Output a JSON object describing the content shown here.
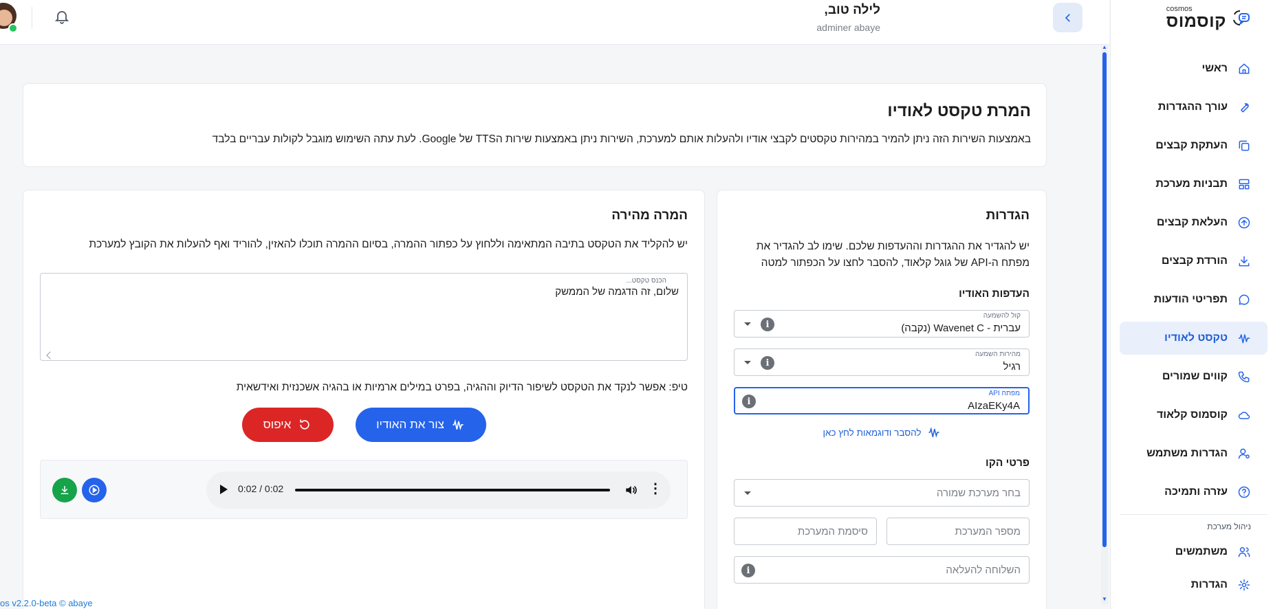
{
  "brand": {
    "small": "cosmos",
    "big": "קוסמוס"
  },
  "header": {
    "greeting": "לילה טוב,",
    "username": "adminer abaye"
  },
  "sidebar": {
    "items": [
      {
        "label": "ראשי",
        "icon": "home-icon"
      },
      {
        "label": "עורך ההגדרות",
        "icon": "wrench-icon"
      },
      {
        "label": "העתקת קבצים",
        "icon": "copy-icon"
      },
      {
        "label": "תבניות מערכת",
        "icon": "layout-icon"
      },
      {
        "label": "העלאת קבצים",
        "icon": "upload-icon"
      },
      {
        "label": "הורדת קבצים",
        "icon": "download-icon"
      },
      {
        "label": "תפריטי הודעות",
        "icon": "message-icon"
      },
      {
        "label": "טקסט לאודיו",
        "icon": "audio-wave-icon",
        "active": true
      },
      {
        "label": "קווים שמורים",
        "icon": "phone-icon"
      },
      {
        "label": "קוסמוס קלאוד",
        "icon": "cloud-icon"
      },
      {
        "label": "הגדרות משתמש",
        "icon": "user-settings-icon"
      },
      {
        "label": "עזרה ותמיכה",
        "icon": "help-icon"
      }
    ],
    "section_label": "ניהול מערכת",
    "admin_items": [
      {
        "label": "משתמשים",
        "icon": "users-icon"
      },
      {
        "label": "הגדרות",
        "icon": "gear-icon"
      }
    ]
  },
  "intro": {
    "title": "המרת טקסט לאודיו",
    "description": "באמצעות השירות הזה ניתן להמיר במהירות טקסטים לקבצי אודיו ולהעלות אותם למערכת, השירות ניתן באמצעות שירות הTTS של Google. לעת עתה השימוש מוגבל לקולות עבריים בלבד"
  },
  "settings": {
    "title": "הגדרות",
    "description": "יש להגדיר את ההגדרות וההעדפות שלכם. שימו לב להגדיר את מפתח ה-API של גוגל קלאוד, להסבר לחצו על הכפתור למטה",
    "audio_prefs_title": "העדפות האודיו",
    "voice": {
      "label": "קול להשמעה",
      "value": "עברית - Wavenet C (נקבה)"
    },
    "speed": {
      "label": "מהירות השמעה",
      "value": "רגיל"
    },
    "api_key": {
      "label": "מפתח API",
      "value": "AIzaEKy4A"
    },
    "help_link": "להסבר ודוגמאות לחץ כאן",
    "line_details_title": "פרטי הקו",
    "saved_system": {
      "placeholder": "בחר מערכת שמורה"
    },
    "system_number": {
      "placeholder": "מספר המערכת"
    },
    "system_password": {
      "placeholder": "סיסמת המערכת"
    },
    "upload_ext": {
      "placeholder": "השלוחה להעלאה"
    }
  },
  "quick": {
    "title": "המרה מהירה",
    "description": "יש להקליד את הטקסט בתיבה המתאימה וללחוץ על כפתור ההמרה, בסיום ההמרה תוכלו להאזין, להוריד ואף להעלות את הקובץ למערכת",
    "text_label": "הכנס טקסט...",
    "text_value": "שלום, זה הדגמה של הממשק",
    "tip": "טיפ: אפשר לנקד את הטקסט לשיפור הדיוק וההגיה, בפרט במילים ארמיות או בהגיה אשכנזית ואידשאית",
    "generate_label": "צור את האודיו",
    "reset_label": "איפוס",
    "audio_time": "0:02 / 0:02"
  },
  "footer": "os v2.2.0-beta © abaye",
  "colors": {
    "accent": "#2563eb",
    "danger": "#dc2626",
    "success": "#16a34a",
    "active_bg": "#e9effb"
  }
}
